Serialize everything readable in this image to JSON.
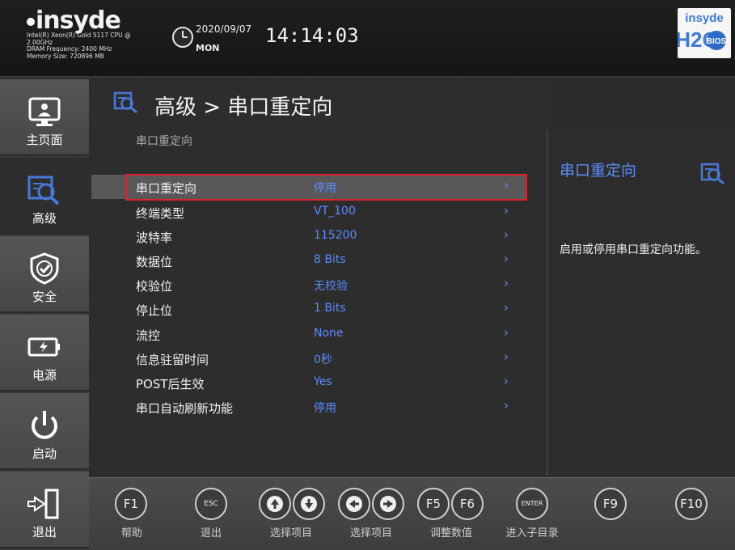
{
  "header": {
    "logo": "insyde",
    "sysinfo": [
      "Intel(R) Xeon(R) Gold 5117 CPU @",
      "2.00GHz",
      "DRAM Frequency: 2400 MHz",
      "Memory Size: 720896 MB"
    ],
    "date": "2020/09/07",
    "day": "MON",
    "time": "14:14:03",
    "brand_logo_text": [
      "insyde",
      "H2O",
      "BIOS"
    ]
  },
  "sidebar": {
    "items": [
      {
        "label": "主页面",
        "icon": "monitor-icon"
      },
      {
        "label": "高级",
        "icon": "advanced-icon"
      },
      {
        "label": "安全",
        "icon": "shield-icon"
      },
      {
        "label": "电源",
        "icon": "battery-icon"
      },
      {
        "label": "启动",
        "icon": "power-icon"
      },
      {
        "label": "退出",
        "icon": "exit-door-icon"
      }
    ],
    "active_index": 1
  },
  "main": {
    "breadcrumb": "高级 > 串口重定向",
    "section_title": "串口重定向",
    "rows": [
      {
        "name": "串口重定向",
        "value": "停用"
      },
      {
        "name": "终端类型",
        "value": "VT_100"
      },
      {
        "name": "波特率",
        "value": "115200"
      },
      {
        "name": "数据位",
        "value": "8 Bits"
      },
      {
        "name": "校验位",
        "value": "无校验"
      },
      {
        "name": "停止位",
        "value": "1 Bits"
      },
      {
        "name": "流控",
        "value": "None"
      },
      {
        "name": "信息驻留时间",
        "value": "0秒"
      },
      {
        "name": "POST后生效",
        "value": "Yes"
      },
      {
        "name": "串口自动刷新功能",
        "value": "停用"
      }
    ],
    "selected_index": 0,
    "chevron": "›"
  },
  "help": {
    "title": "串口重定向",
    "text": "启用或停用串口重定向功能。"
  },
  "bottom_bar": {
    "keys": [
      {
        "key": "F1",
        "label": "帮助"
      },
      {
        "key": "ESC",
        "label": "退出"
      },
      {
        "key": "up-down",
        "label": "选择项目"
      },
      {
        "key": "left-right",
        "label": "选择项目"
      },
      {
        "key": "F5 F6",
        "label": "调整数值"
      },
      {
        "key": "ENTER",
        "label": "进入子目录"
      },
      {
        "key": "F9",
        "label": ""
      },
      {
        "key": "F10",
        "label": ""
      }
    ]
  },
  "colors": {
    "accent": "#5b8dff",
    "highlight_border": "#e0202a",
    "background": "#2d2d2d"
  }
}
